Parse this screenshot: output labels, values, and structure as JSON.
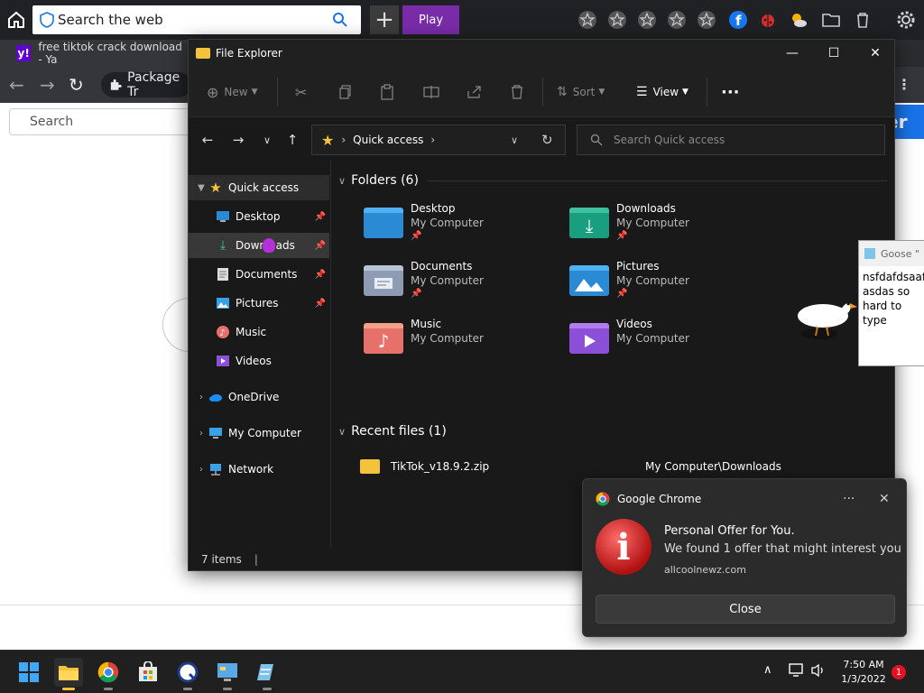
{
  "browser": {
    "search_placeholder": "Search the web",
    "play_label": "Play",
    "tab_title": "free tiktok crack download - Ya",
    "address_chip": "Package Tr",
    "page_search_placeholder": "Search",
    "blue_button_text": "er"
  },
  "file_explorer": {
    "title": "File Explorer",
    "toolbar": {
      "new_label": "New",
      "sort_label": "Sort",
      "view_label": "View"
    },
    "address": "Quick access",
    "search_placeholder": "Search Quick access",
    "sidebar": {
      "quick_access": "Quick access",
      "items": [
        {
          "label": "Desktop"
        },
        {
          "label": "Downloads"
        },
        {
          "label": "Documents"
        },
        {
          "label": "Pictures"
        },
        {
          "label": "Music"
        },
        {
          "label": "Videos"
        }
      ],
      "onedrive": "OneDrive",
      "my_computer": "My Computer",
      "network": "Network"
    },
    "folders_header": "Folders (6)",
    "folders": [
      {
        "name": "Desktop",
        "location": "My Computer"
      },
      {
        "name": "Downloads",
        "location": "My Computer"
      },
      {
        "name": "Documents",
        "location": "My Computer"
      },
      {
        "name": "Pictures",
        "location": "My Computer"
      },
      {
        "name": "Music",
        "location": "My Computer"
      },
      {
        "name": "Videos",
        "location": "My Computer"
      }
    ],
    "recent_header": "Recent files (1)",
    "recent_files": [
      {
        "name": "TikTok_v18.9.2.zip",
        "path": "My Computer\\Downloads"
      }
    ],
    "status": "7 items"
  },
  "goose": {
    "title": "Goose \"",
    "text": "nsfdafdsaaf asdas so hard to type"
  },
  "notification": {
    "app": "Google Chrome",
    "title": "Personal Offer for You.",
    "body": "We found 1 offer that might interest you",
    "source": "allcoolnewz.com",
    "close_label": "Close"
  },
  "taskbar": {
    "time": "7:50 AM",
    "date": "1/3/2022",
    "badge": "1"
  },
  "colors": {
    "accent_purple": "#7a2ca8",
    "folder_yellow": "#f5c33b",
    "chrome_blue": "#1a73e8",
    "alert_red": "#b01010"
  }
}
